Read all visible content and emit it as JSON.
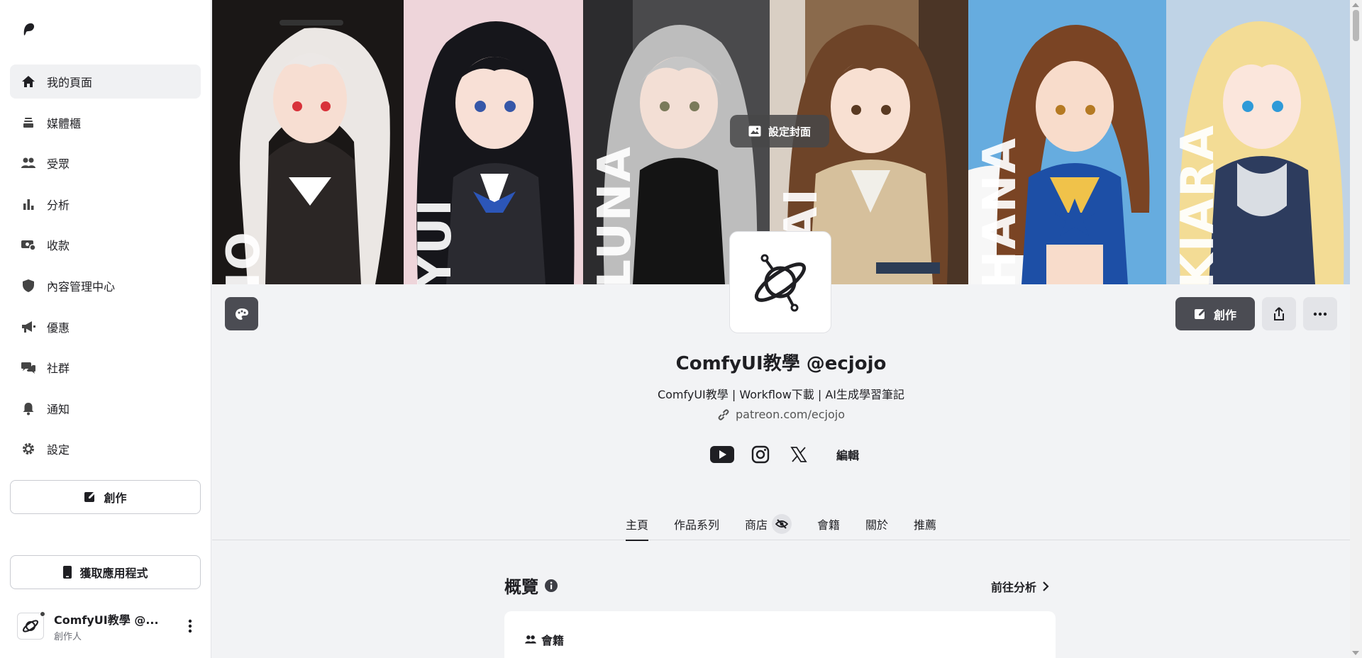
{
  "sidebar": {
    "logo_icon": "patreon-logo-icon",
    "items": [
      {
        "label": "我的頁面",
        "icon": "home-icon",
        "active": true
      },
      {
        "label": "媒體櫃",
        "icon": "library-icon"
      },
      {
        "label": "受眾",
        "icon": "audience-icon"
      },
      {
        "label": "分析",
        "icon": "chart-icon"
      },
      {
        "label": "收款",
        "icon": "payout-icon"
      },
      {
        "label": "內容管理中心",
        "icon": "shield-icon"
      },
      {
        "label": "優惠",
        "icon": "megaphone-icon"
      },
      {
        "label": "社群",
        "icon": "chat-icon"
      },
      {
        "label": "通知",
        "icon": "bell-icon"
      },
      {
        "label": "設定",
        "icon": "gear-icon"
      }
    ],
    "create_label": "創作",
    "get_app_label": "獲取應用程式",
    "user": {
      "name": "ComfyUI教學 @...",
      "role": "創作人"
    }
  },
  "cover": {
    "set_cover_label": "設定封面",
    "panels": [
      {
        "tag": "IO",
        "bg": "#2a2624",
        "accent": "#e9e5e2"
      },
      {
        "tag": "YUI",
        "bg": "#1c1c22",
        "accent": "#2c56b8"
      },
      {
        "tag": "LUNA",
        "bg": "#3a3a3c",
        "accent": "#b9b9b9"
      },
      {
        "tag": "MAI",
        "bg": "#6d4a33",
        "accent": "#d8c4a2"
      },
      {
        "tag": "HANA",
        "bg": "#5aa0d6",
        "accent": "#e0b34a"
      },
      {
        "tag": "KIARA",
        "bg": "#7fa4c7",
        "accent": "#f3dd9a"
      }
    ]
  },
  "profile": {
    "name": "ComfyUI教學 @ecjojo",
    "description": "ComfyUI教學 | Workflow下載 | AI生成學習筆記",
    "link": "patreon.com/ecjojo",
    "edit_label": "編輯",
    "create_label": "創作",
    "social": [
      "youtube-icon",
      "instagram-icon",
      "x-icon"
    ]
  },
  "tabs": [
    {
      "label": "主頁",
      "active": true
    },
    {
      "label": "作品系列"
    },
    {
      "label": "商店",
      "hidden_icon": true
    },
    {
      "label": "會籍"
    },
    {
      "label": "關於"
    },
    {
      "label": "推薦"
    }
  ],
  "overview": {
    "title": "概覽",
    "goto_label": "前往分析",
    "card_title": "會籍"
  },
  "colors": {
    "accent_dark": "#4b4c53",
    "sidebar_bg": "#ffffff",
    "page_bg": "#f2f3f5"
  }
}
